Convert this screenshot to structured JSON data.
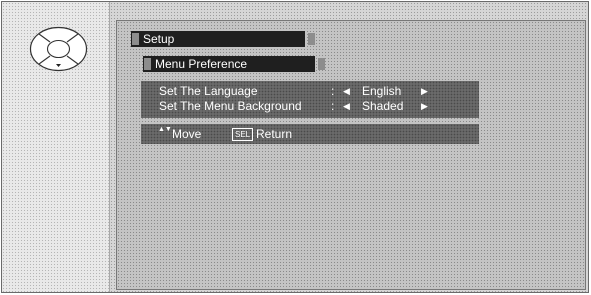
{
  "menu": {
    "title": "Setup",
    "submenu": "Menu Preference"
  },
  "settings": [
    {
      "label": "Set The Language",
      "value": "English"
    },
    {
      "label": "Set The Menu Background",
      "value": "Shaded"
    }
  ],
  "separator": ":",
  "arrows": {
    "left": "◀",
    "right": "▶"
  },
  "hints": {
    "updown_icon": "▲▼",
    "move_label": "Move",
    "sel_key": "SEL",
    "return_label": "Return"
  },
  "icons": [
    "dpad-icon",
    "tab-cap-icon",
    "left-arrow-icon",
    "right-arrow-icon",
    "updown-icon",
    "sel-key-icon"
  ]
}
